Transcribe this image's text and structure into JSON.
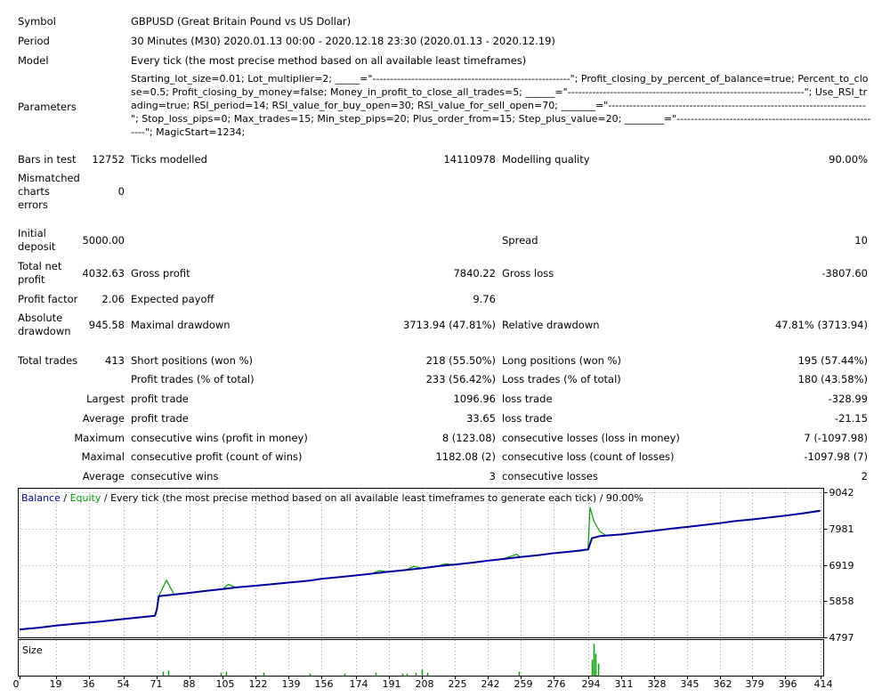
{
  "report": {
    "symbol_label": "Symbol",
    "symbol_value": "GBPUSD (Great Britain Pound vs US Dollar)",
    "period_label": "Period",
    "period_value": "30 Minutes (M30) 2020.01.13 00:00 - 2020.12.18 23:30 (2020.01.13 - 2020.12.19)",
    "model_label": "Model",
    "model_value": "Every tick (the most precise method based on all available least timeframes)",
    "parameters_label": "Parameters",
    "parameters_value": "Starting_lot_size=0.01; Lot_multiplier=2; _____=\"--------------------------------------------------------\"; Profit_closing_by_percent_of_balance=true; Percent_to_close=0.5; Profit_closing_by_money=false; Money_in_profit_to_close_all_trades=5; ______=\"-------------------------------------------------------------------\"; Use_RSI_trading=true; RSI_period=14; RSI_value_for_buy_open=30; RSI_value_for_sell_open=70; _______=\"-------------------------------------------------------------------------\"; Stop_loss_pips=0; Max_trades=15; Min_step_pips=20; Plus_order_from=15; Step_plus_value=20; ________=\"-----------------------------------------------------------\"; MagicStart=1234;",
    "bars_label": "Bars in test",
    "bars_value": "12752",
    "ticks_label": "Ticks modelled",
    "ticks_value": "14110978",
    "quality_label": "Modelling quality",
    "quality_value": "90.00%",
    "mismatched_label": "Mismatched charts errors",
    "mismatched_value": "0",
    "deposit_label": "Initial deposit",
    "deposit_value": "5000.00",
    "spread_label": "Spread",
    "spread_value": "10",
    "netprofit_label": "Total net profit",
    "netprofit_value": "4032.63",
    "grossprofit_label": "Gross profit",
    "grossprofit_value": "7840.22",
    "grossloss_label": "Gross loss",
    "grossloss_value": "-3807.60",
    "pf_label": "Profit factor",
    "pf_value": "2.06",
    "payoff_label": "Expected payoff",
    "payoff_value": "9.76",
    "absdd_label": "Absolute drawdown",
    "absdd_value": "945.58",
    "maxdd_label": "Maximal drawdown",
    "maxdd_value": "3713.94 (47.81%)",
    "reldd_label": "Relative drawdown",
    "reldd_value": "47.81% (3713.94)",
    "trades_label": "Total trades",
    "trades_value": "413",
    "short_label": "Short positions (won %)",
    "short_value": "218 (55.50%)",
    "long_label": "Long positions (won %)",
    "long_value": "195 (57.44%)",
    "profittrades_label": "Profit trades (% of total)",
    "profittrades_value": "233 (56.42%)",
    "losstrades_label": "Loss trades (% of total)",
    "losstrades_value": "180 (43.58%)",
    "largest_label": "Largest",
    "largest_profit_label": "profit trade",
    "largest_profit_value": "1096.96",
    "largest_loss_label": "loss trade",
    "largest_loss_value": "-328.99",
    "average_label": "Average",
    "average_profit_label": "profit trade",
    "average_profit_value": "33.65",
    "average_loss_label": "loss trade",
    "average_loss_value": "-21.15",
    "maximum_label": "Maximum",
    "maxconswins_label": "consecutive wins (profit in money)",
    "maxconswins_value": "8 (123.08)",
    "maxconslosses_label": "consecutive losses (loss in money)",
    "maxconslosses_value": "7 (-1097.98)",
    "maximal_label": "Maximal",
    "maxconsprofit_label": "consecutive profit (count of wins)",
    "maxconsprofit_value": "1182.08 (2)",
    "maxconsloss_label": "consecutive loss (count of losses)",
    "maxconsloss_value": "-1097.98 (7)",
    "average2_label": "Average",
    "avgconswins_label": "consecutive wins",
    "avgconswins_value": "3",
    "avgconslosses_label": "consecutive losses",
    "avgconslosses_value": "2"
  },
  "chart_legend": {
    "balance": "Balance",
    "sep1": " / ",
    "equity": "Equity",
    "rest": " / Every tick (the most precise method based on all available least timeframes to generate each tick) / 90.00%"
  },
  "size_label": "Size",
  "colors": {
    "balance": "#0000a0",
    "equity": "#00a000",
    "grid": "#a0a0a0"
  },
  "chart_data": {
    "type": "line",
    "title": "",
    "xlabel": "",
    "ylabel": "",
    "y_ticks": [
      4797,
      5858,
      6919,
      7981,
      9042
    ],
    "x_ticks": [
      0,
      19,
      36,
      54,
      71,
      88,
      105,
      122,
      139,
      156,
      174,
      191,
      208,
      225,
      242,
      259,
      276,
      294,
      311,
      328,
      345,
      362,
      379,
      396,
      414
    ],
    "xlim": [
      0,
      414
    ],
    "ylim": [
      4797,
      9150
    ],
    "series": [
      {
        "name": "Balance",
        "x": [
          0,
          10,
          20,
          30,
          40,
          50,
          60,
          70,
          71,
          72,
          80,
          88,
          95,
          105,
          112,
          122,
          130,
          139,
          150,
          156,
          165,
          174,
          182,
          191,
          200,
          208,
          216,
          225,
          235,
          242,
          250,
          259,
          268,
          276,
          285,
          294,
          296,
          300,
          311,
          320,
          328,
          337,
          345,
          354,
          362,
          370,
          379,
          388,
          396,
          404,
          414
        ],
        "y": [
          5030,
          5080,
          5150,
          5200,
          5250,
          5310,
          5370,
          5430,
          5620,
          6000,
          6050,
          6100,
          6150,
          6210,
          6260,
          6310,
          6350,
          6400,
          6460,
          6510,
          6560,
          6610,
          6660,
          6720,
          6770,
          6820,
          6880,
          6930,
          6990,
          7040,
          7090,
          7150,
          7200,
          7260,
          7310,
          7370,
          7700,
          7760,
          7810,
          7870,
          7920,
          7980,
          8030,
          8090,
          8140,
          8200,
          8250,
          8310,
          8360,
          8420,
          8500
        ]
      },
      {
        "name": "Equity",
        "x": [
          0,
          10,
          20,
          30,
          40,
          50,
          60,
          70,
          71,
          72,
          76,
          78,
          80,
          88,
          95,
          105,
          108,
          110,
          112,
          122,
          130,
          139,
          150,
          156,
          165,
          174,
          182,
          186,
          191,
          200,
          204,
          208,
          216,
          220,
          225,
          235,
          242,
          250,
          257,
          259,
          268,
          276,
          285,
          290,
          294,
          295,
          297,
          300,
          303,
          311,
          320,
          328,
          337,
          345,
          354,
          362,
          370,
          379,
          388,
          396,
          404,
          414
        ],
        "y": [
          5030,
          5080,
          5150,
          5200,
          5250,
          5310,
          5370,
          5430,
          5620,
          6000,
          6470,
          6250,
          6050,
          6100,
          6150,
          6210,
          6350,
          6300,
          6260,
          6310,
          6350,
          6400,
          6460,
          6510,
          6560,
          6610,
          6660,
          6750,
          6720,
          6770,
          6880,
          6820,
          6880,
          6950,
          6930,
          6990,
          7040,
          7090,
          7230,
          7150,
          7200,
          7260,
          7310,
          7320,
          7380,
          8600,
          8200,
          7900,
          7790,
          7810,
          7870,
          7920,
          7980,
          8030,
          8090,
          8140,
          8200,
          8250,
          8310,
          8360,
          8420,
          8520
        ]
      },
      {
        "name": "Size",
        "x": [
          74,
          77,
          104,
          107,
          126,
          150,
          168,
          184,
          198,
          200,
          205,
          208,
          211,
          258,
          296,
          297,
          298,
          299
        ],
        "y": [
          0.04,
          0.05,
          0.03,
          0.04,
          0.03,
          0.02,
          0.02,
          0.03,
          0.02,
          0.02,
          0.03,
          0.06,
          0.03,
          0.04,
          0.16,
          0.32,
          0.22,
          0.12
        ]
      }
    ]
  }
}
